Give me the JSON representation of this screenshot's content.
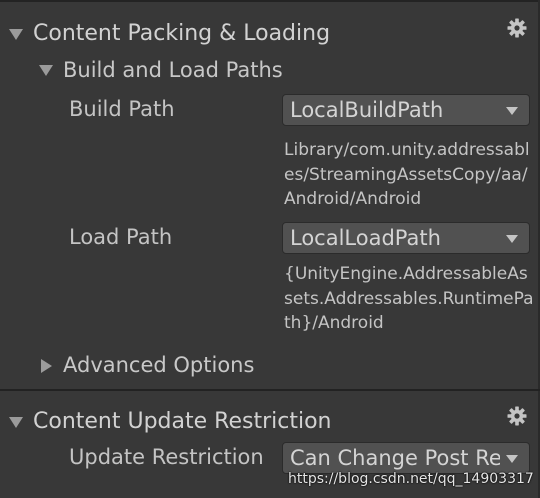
{
  "sections": [
    {
      "header": "Content Packing & Loading",
      "group_title": "Build and Load Paths",
      "build_path": {
        "label": "Build Path",
        "selected": "LocalBuildPath",
        "resolved": "Library/com.unity.addressables/StreamingAssetsCopy/aa/Android/Android"
      },
      "load_path": {
        "label": "Load Path",
        "selected": "LocalLoadPath",
        "resolved": "{UnityEngine.AddressableAssets.Addressables.RuntimePath}/Android"
      },
      "advanced": "Advanced Options"
    },
    {
      "header": "Content Update Restriction",
      "update_restriction": {
        "label": "Update Restriction",
        "selected": "Can Change Post Release"
      }
    }
  ],
  "watermark": "https://blog.csdn.net/qq_14903317",
  "icons": [
    "gear-icon",
    "expanded-triangle-icon",
    "collapsed-triangle-icon",
    "dropdown-arrow-icon"
  ]
}
